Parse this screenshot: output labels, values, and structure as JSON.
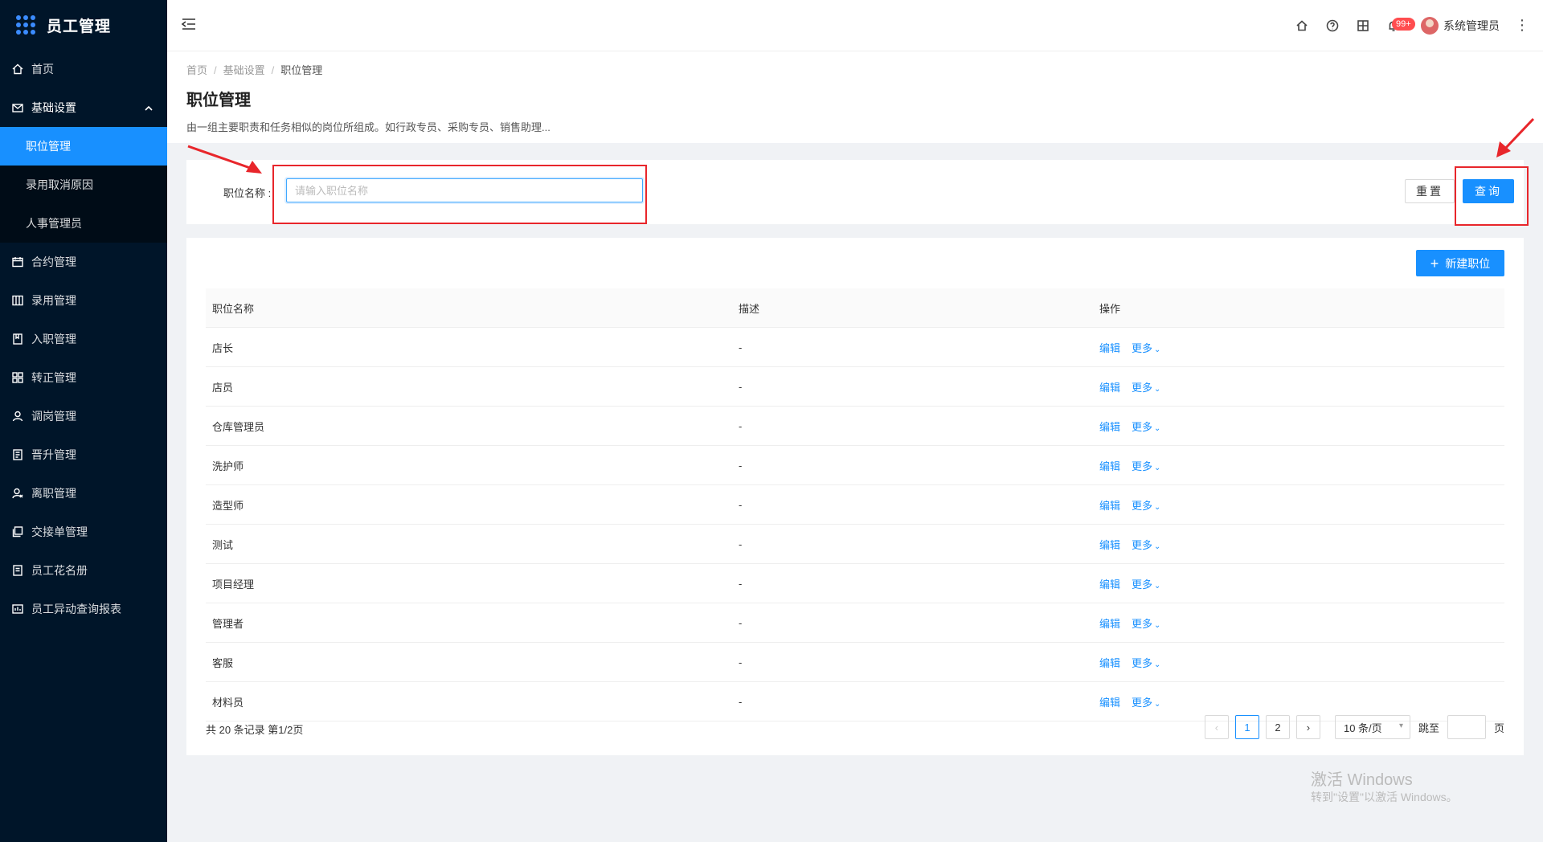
{
  "app": {
    "title": "员工管理"
  },
  "sidebar": {
    "items": [
      {
        "label": "首页",
        "icon": "home-icon"
      },
      {
        "label": "基础设置",
        "icon": "mail-icon",
        "open": true,
        "children": [
          {
            "label": "职位管理",
            "active": true
          },
          {
            "label": "录用取消原因"
          },
          {
            "label": "人事管理员"
          }
        ]
      },
      {
        "label": "合约管理",
        "icon": "calendar-icon"
      },
      {
        "label": "录用管理",
        "icon": "layout-icon"
      },
      {
        "label": "入职管理",
        "icon": "book-icon"
      },
      {
        "label": "转正管理",
        "icon": "grid-icon"
      },
      {
        "label": "调岗管理",
        "icon": "user-icon"
      },
      {
        "label": "晋升管理",
        "icon": "report-icon"
      },
      {
        "label": "离职管理",
        "icon": "user-leave-icon"
      },
      {
        "label": "交接单管理",
        "icon": "copy-icon"
      },
      {
        "label": "员工花名册",
        "icon": "roster-icon"
      },
      {
        "label": "员工异动查询报表",
        "icon": "chart-report-icon"
      }
    ]
  },
  "header": {
    "notification_count": "99+",
    "user_name": "系统管理员"
  },
  "breadcrumb": [
    "首页",
    "基础设置",
    "职位管理"
  ],
  "page": {
    "title": "职位管理",
    "description": "由一组主要职责和任务相似的岗位所组成。如行政专员、采购专员、销售助理..."
  },
  "search": {
    "label": "职位名称 :",
    "placeholder": "请输入职位名称",
    "value": "",
    "reset_label": "重置",
    "query_label": "查询"
  },
  "table": {
    "new_button_label": "新建职位",
    "columns": [
      "职位名称",
      "描述",
      "操作"
    ],
    "rows": [
      {
        "name": "店长",
        "desc": "-"
      },
      {
        "name": "店员",
        "desc": "-"
      },
      {
        "name": "仓库管理员",
        "desc": "-"
      },
      {
        "name": "洗护师",
        "desc": "-"
      },
      {
        "name": "造型师",
        "desc": "-"
      },
      {
        "name": "测试",
        "desc": "-"
      },
      {
        "name": "项目经理",
        "desc": "-"
      },
      {
        "name": "管理者",
        "desc": "-"
      },
      {
        "name": "客服",
        "desc": "-"
      },
      {
        "name": "材料员",
        "desc": "-"
      }
    ],
    "edit_label": "编辑",
    "more_label": "更多"
  },
  "pagination": {
    "summary": "共 20 条记录 第1/2页",
    "pages": [
      "1",
      "2"
    ],
    "current": "1",
    "page_size": "10 条/页",
    "jump_label": "跳至",
    "page_suffix": "页"
  },
  "watermark": {
    "line1": "激活 Windows",
    "line2": "转到\"设置\"以激活 Windows。"
  },
  "colors": {
    "primary": "#1890ff",
    "sidebar": "#001529",
    "annotation": "#e8262b"
  }
}
